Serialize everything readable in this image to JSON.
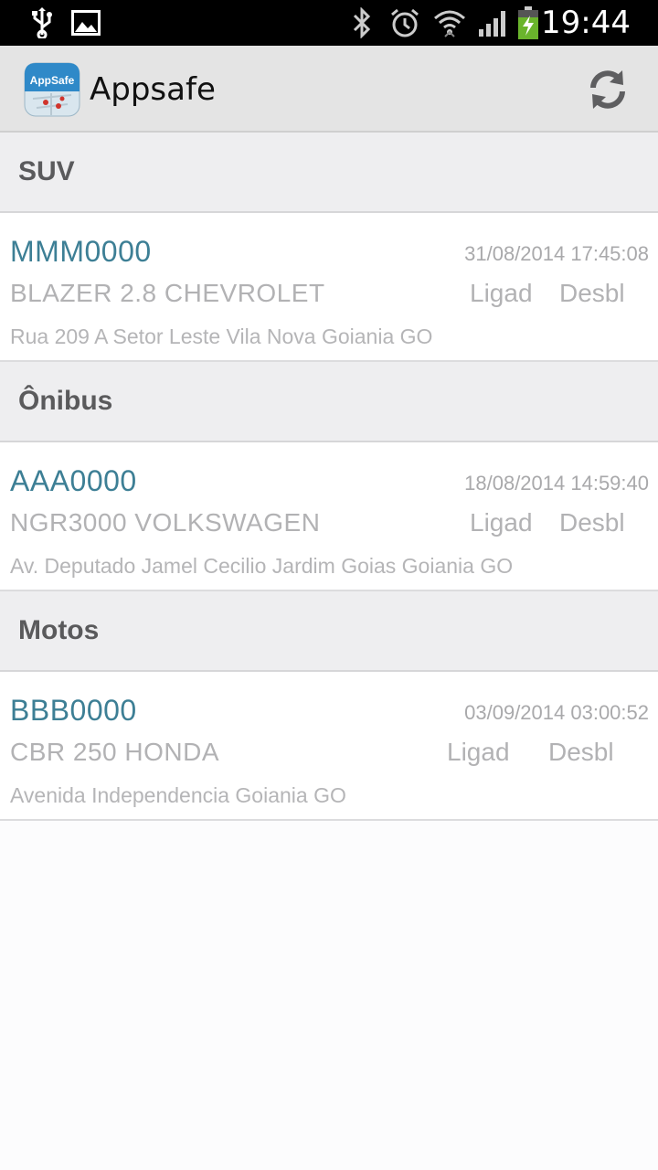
{
  "status_bar": {
    "time": "19:44",
    "icons": [
      "usb-icon",
      "image-icon",
      "bluetooth-icon",
      "alarm-icon",
      "wifi-icon",
      "signal-icon",
      "battery-charging-icon"
    ]
  },
  "action_bar": {
    "title": "Appsafe",
    "logo_text": "AppSafe",
    "refresh_icon": "refresh-icon"
  },
  "sections": [
    {
      "title": "SUV",
      "vehicles": [
        {
          "plate": "MMM0000",
          "timestamp": "31/08/2014 17:45:08",
          "model": "BLAZER 2.8 CHEVROLET",
          "ignition": "Ligad",
          "lock": "Desbl",
          "address": "Rua 209 A Setor Leste Vila Nova Goiania GO"
        }
      ]
    },
    {
      "title": "Ônibus",
      "vehicles": [
        {
          "plate": "AAA0000",
          "timestamp": "18/08/2014 14:59:40",
          "model": "NGR3000 VOLKSWAGEN",
          "ignition": "Ligad",
          "lock": "Desbl",
          "address": "Av. Deputado Jamel Cecilio Jardim Goias Goiania GO"
        }
      ]
    },
    {
      "title": "Motos",
      "vehicles": [
        {
          "plate": "BBB0000",
          "timestamp": "03/09/2014 03:00:52",
          "model": "CBR 250 HONDA",
          "ignition": "Ligad",
          "lock": "Desbl",
          "address": "Avenida Independencia  Goiania GO"
        }
      ]
    }
  ]
}
